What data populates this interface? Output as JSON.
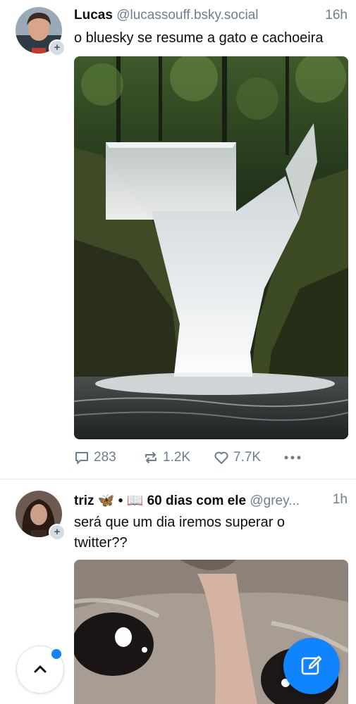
{
  "posts": [
    {
      "author": "Lucas",
      "handle": "@lucassouff.bsky.social",
      "time": "16h",
      "text": "o bluesky se resume a gato e cachoeira",
      "media_icon": "waterfall-image",
      "actions": {
        "replies": "283",
        "reposts": "1.2K",
        "likes": "7.7K"
      }
    },
    {
      "author": "triz 🦋 • 📖 60 dias com ele",
      "handle": "@grey...",
      "time": "1h",
      "text_line1": "será que um dia iremos superar o",
      "text_line2": "twitter??",
      "media_icon": "crying-cat-image"
    }
  ],
  "colors": {
    "accent": "#1083fe",
    "muted": "#6f7e8e",
    "text": "#0b0f14"
  },
  "icons": {
    "reply": "reply-icon",
    "repost": "repost-icon",
    "like": "heart-icon",
    "more": "more-icon",
    "scroll_top": "chevron-up-icon",
    "compose": "compose-icon"
  }
}
